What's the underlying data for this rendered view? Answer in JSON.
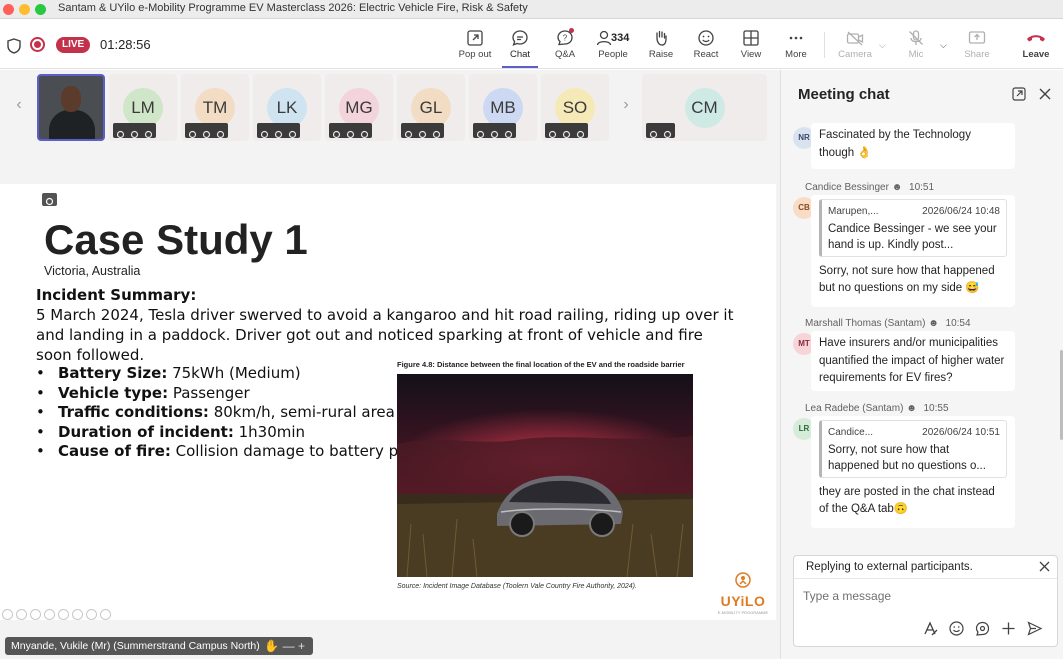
{
  "window": {
    "title": "Santam & UYilo e-Mobility Programme EV Masterclass 2026: Electric Vehicle Fire, Risk & Safety"
  },
  "toolbar": {
    "live_label": "LIVE",
    "timer": "01:28:56",
    "people_count": "334",
    "buttons": {
      "popout": "Pop out",
      "chat": "Chat",
      "qa": "Q&A",
      "people": "People",
      "raise": "Raise",
      "react": "React",
      "view": "View",
      "more": "More",
      "camera": "Camera",
      "mic": "Mic",
      "share": "Share",
      "leave": "Leave"
    }
  },
  "participants": [
    {
      "initials": "LM",
      "color": "#cfe6c8"
    },
    {
      "initials": "TM",
      "color": "#f2dcc4"
    },
    {
      "initials": "LK",
      "color": "#cfe3f0"
    },
    {
      "initials": "MG",
      "color": "#f3d3dc"
    },
    {
      "initials": "GL",
      "color": "#f2dcc4"
    },
    {
      "initials": "MB",
      "color": "#cdd9f2"
    },
    {
      "initials": "SO",
      "color": "#f6e9b8"
    },
    {
      "initials": "CM",
      "color": "#cfeae4"
    }
  ],
  "slide": {
    "title": "Case Study 1",
    "subtitle": "Victoria, Australia",
    "incident_heading": "Incident Summary:",
    "incident_body": "5 March 2024, Tesla driver swerved to avoid a kangaroo and hit road railing, riding up over it and landing in a paddock. Driver got out and noticed sparking at front of vehicle and fire soon followed.",
    "bullets": [
      {
        "label": "Battery Size:",
        "value": " 75kWh (Medium)"
      },
      {
        "label": "Vehicle type:",
        "value": " Passenger"
      },
      {
        "label": "Traffic conditions:",
        "value": " 80km/h, semi-rural area"
      },
      {
        "label": "Duration of incident:",
        "value": " 1h30min"
      },
      {
        "label": "Cause of fire:",
        "value": " Collision damage to battery pack"
      }
    ],
    "figure_caption": "Figure 4.8:      Distance between the final location of the EV and the roadside barrier",
    "figure_source": "Source: Incident Image Database (Toolern Vale Country Fire Authority, 2024).",
    "logo": "UYiLO",
    "logo_tag": "E-MOBILITY PROGRAMME"
  },
  "presenter": {
    "name": "Mnyande, Vukile (Mr) (Summerstrand Campus North)"
  },
  "chat": {
    "title": "Meeting chat",
    "messages": [
      {
        "initials": "NR",
        "avatar_color": "#d9e3ef",
        "text": "Fascinated by the Technology though 👌"
      },
      {
        "sender": "Candice Bessinger",
        "time": "10:51",
        "initials": "CB",
        "avatar_color": "#f8dcc6",
        "quote": {
          "author": "Marupen,...",
          "date": "2026/06/24 10:48",
          "text": "Candice Bessinger - we see your hand is up. Kindly post..."
        },
        "text": "Sorry, not sure how that happened but no questions on my side 😅"
      },
      {
        "sender": "Marshall Thomas (Santam)",
        "time": "10:54",
        "initials": "MT",
        "avatar_color": "#f6d4d8",
        "text": "Have insurers and/or municipalities quantified the impact of higher water requirements for EV fires?"
      },
      {
        "sender": "Lea Radebe (Santam)",
        "time": "10:55",
        "initials": "LR",
        "avatar_color": "#d6ecd8",
        "quote": {
          "author": "Candice...",
          "date": "2026/06/24 10:51",
          "text": "Sorry, not sure how that happened but no questions o..."
        },
        "text": "they are posted in the chat instead of the Q&A tab🙃"
      }
    ],
    "reply_banner": "Replying to external participants.",
    "compose_placeholder": "Type a message"
  }
}
